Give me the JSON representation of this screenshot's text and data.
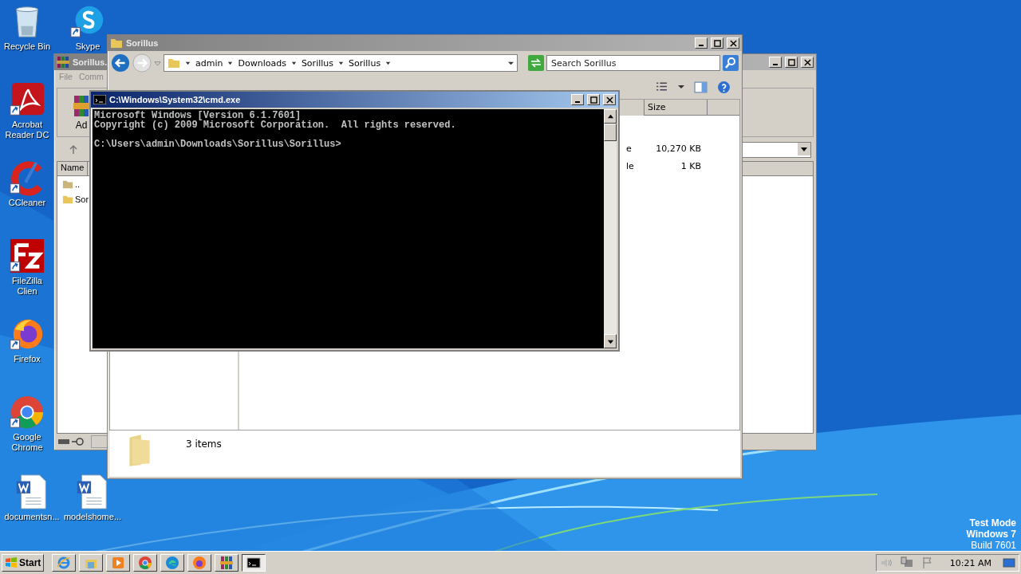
{
  "desktop_icons": [
    {
      "kind": "recycle",
      "label": "Recycle Bin"
    },
    {
      "kind": "skype",
      "label": "Skype"
    },
    {
      "kind": "acrobat",
      "label": "Acrobat Reader DC"
    },
    {
      "kind": "ccleaner",
      "label": "CCleaner"
    },
    {
      "kind": "filezilla",
      "label": "FileZilla Clien"
    },
    {
      "kind": "firefox",
      "label": "Firefox"
    },
    {
      "kind": "chrome",
      "label": "Google Chrome"
    },
    {
      "kind": "word",
      "label": "documentsn..."
    },
    {
      "kind": "word",
      "label": "modelshome..."
    }
  ],
  "archive_window": {
    "title": "Sorillus.",
    "menu": [
      "File",
      "Comm"
    ],
    "toolbar_label": "Ad",
    "column": "Name",
    "rows": [
      "..",
      "Sor"
    ]
  },
  "explorer_window": {
    "title": "Sorillus",
    "breadcrumb": [
      "admin",
      "Downloads",
      "Sorillus",
      "Sorillus"
    ],
    "search": {
      "placeholder": "Search Sorillus"
    },
    "columns": [
      "Size"
    ],
    "rows": [
      {
        "type": "e",
        "size": "10,270 KB"
      },
      {
        "type": "le",
        "size": "1 KB"
      }
    ],
    "status": "3 items"
  },
  "cmd_window": {
    "title": "C:\\Windows\\System32\\cmd.exe",
    "output": [
      "Microsoft Windows [Version 6.1.7601]",
      "Copyright (c) 2009 Microsoft Corporation.  All rights reserved."
    ],
    "prompt": "C:\\Users\\admin\\Downloads\\Sorillus\\Sorillus>"
  },
  "os_notice": [
    "Test Mode",
    "Windows 7",
    "Build 7601"
  ],
  "taskbar": {
    "start": "Start",
    "apps": [
      {
        "kind": "ie",
        "selected": false
      },
      {
        "kind": "explorer",
        "selected": false
      },
      {
        "kind": "media",
        "selected": false
      },
      {
        "kind": "chrome",
        "selected": false
      },
      {
        "kind": "edge",
        "selected": false
      },
      {
        "kind": "firefox",
        "selected": false
      },
      {
        "kind": "winrar",
        "selected": false
      },
      {
        "kind": "cmd",
        "selected": true
      }
    ],
    "clock": "10:21 AM"
  }
}
